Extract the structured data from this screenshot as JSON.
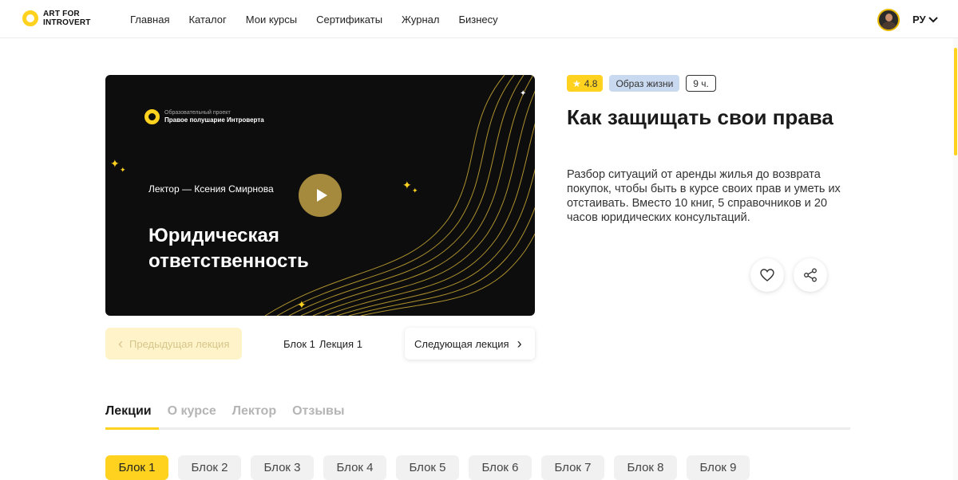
{
  "header": {
    "logo_line1": "ART FOR",
    "logo_line2": "INTROVERT",
    "nav": [
      "Главная",
      "Каталог",
      "Мои курсы",
      "Сертификаты",
      "Журнал",
      "Бизнесу"
    ],
    "lang": "РУ"
  },
  "video": {
    "project_subtitle": "Образовательный проект",
    "project_title": "Правое полушарие Интроверта",
    "lector": "Лектор — Ксения Смирнова",
    "title_line1": "Юридическая",
    "title_line2": "ответственность"
  },
  "lecture_nav": {
    "prev_label": "Предыдущая лекция",
    "block": "Блок 1",
    "lecture": "Лекция 1",
    "next_label": "Следующая лекция"
  },
  "course": {
    "rating": "4.8",
    "category": "Образ жизни",
    "duration": "9 ч.",
    "title": "Как защищать свои права",
    "description": "Разбор ситуаций от аренды жилья до возврата покупок, чтобы быть в курсе своих прав и уметь их отстаивать. Вместо 10 книг, 5 справочников и 20 часов юридических консультаций."
  },
  "tabs": [
    "Лекции",
    "О курсе",
    "Лектор",
    "Отзывы"
  ],
  "blocks": [
    "Блок 1",
    "Блок 2",
    "Блок 3",
    "Блок 4",
    "Блок 5",
    "Блок 6",
    "Блок 7",
    "Блок 8",
    "Блок 9"
  ],
  "colors": {
    "accent": "#ffd21f",
    "category_bg": "#c9daf0",
    "video_bg": "#0d0d0d",
    "play_button": "#a58a3e"
  }
}
